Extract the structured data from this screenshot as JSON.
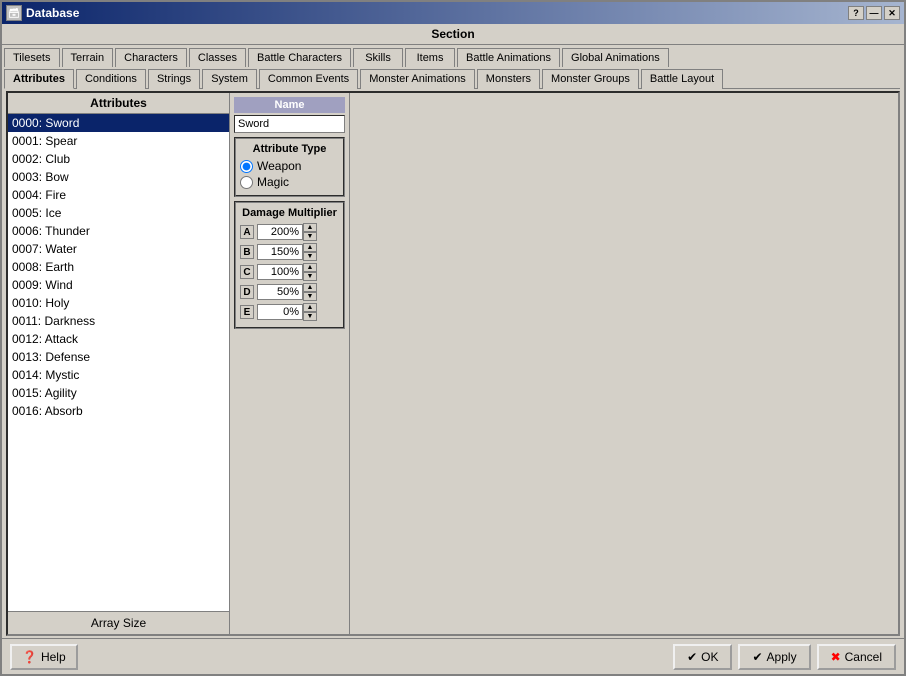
{
  "window": {
    "title": "Database",
    "title_left_icon": "⬜",
    "controls": [
      "?",
      "—",
      "✕"
    ]
  },
  "section_label": "Section",
  "tab_row1": [
    {
      "id": "tilesets",
      "label": "Tilesets"
    },
    {
      "id": "terrain",
      "label": "Terrain"
    },
    {
      "id": "characters",
      "label": "Characters"
    },
    {
      "id": "classes",
      "label": "Classes"
    },
    {
      "id": "battle-characters",
      "label": "Battle Characters"
    },
    {
      "id": "skills",
      "label": "Skills"
    },
    {
      "id": "items",
      "label": "Items"
    },
    {
      "id": "battle-animations",
      "label": "Battle Animations"
    },
    {
      "id": "global-animations",
      "label": "Global Animations"
    }
  ],
  "tab_row2": [
    {
      "id": "attributes",
      "label": "Attributes",
      "active": true
    },
    {
      "id": "conditions",
      "label": "Conditions"
    },
    {
      "id": "strings",
      "label": "Strings"
    },
    {
      "id": "system",
      "label": "System"
    },
    {
      "id": "common-events",
      "label": "Common Events"
    },
    {
      "id": "monster-animations",
      "label": "Monster Animations"
    },
    {
      "id": "monsters",
      "label": "Monsters"
    },
    {
      "id": "monster-groups",
      "label": "Monster Groups"
    },
    {
      "id": "battle-layout",
      "label": "Battle Layout"
    }
  ],
  "left_panel": {
    "header": "Attributes",
    "items": [
      {
        "id": "0000",
        "name": "Sword",
        "selected": true
      },
      {
        "id": "0001",
        "name": "Spear"
      },
      {
        "id": "0002",
        "name": "Club"
      },
      {
        "id": "0003",
        "name": "Bow"
      },
      {
        "id": "0004",
        "name": "Fire"
      },
      {
        "id": "0005",
        "name": "Ice"
      },
      {
        "id": "0006",
        "name": "Thunder"
      },
      {
        "id": "0007",
        "name": "Water"
      },
      {
        "id": "0008",
        "name": "Earth"
      },
      {
        "id": "0009",
        "name": "Wind"
      },
      {
        "id": "0010",
        "name": "Holy"
      },
      {
        "id": "0011",
        "name": "Darkness"
      },
      {
        "id": "0012",
        "name": "Attack"
      },
      {
        "id": "0013",
        "name": "Defense"
      },
      {
        "id": "0014",
        "name": "Mystic"
      },
      {
        "id": "0015",
        "name": "Agility"
      },
      {
        "id": "0016",
        "name": "Absorb"
      }
    ],
    "array_size": "Array Size"
  },
  "detail_panel": {
    "name_label": "Name",
    "name_value": "Sword",
    "attribute_type": {
      "title": "Attribute Type",
      "options": [
        {
          "label": "Weapon",
          "selected": true
        },
        {
          "label": "Magic",
          "selected": false
        }
      ]
    },
    "damage_multiplier": {
      "title": "Damage Multiplier",
      "rows": [
        {
          "label": "A",
          "value": "200%"
        },
        {
          "label": "B",
          "value": "150%"
        },
        {
          "label": "C",
          "value": "100%"
        },
        {
          "label": "D",
          "value": "50%"
        },
        {
          "label": "E",
          "value": "0%"
        }
      ]
    }
  },
  "bottom": {
    "help_label": "Help",
    "ok_label": "OK",
    "apply_label": "Apply",
    "cancel_label": "Cancel"
  }
}
